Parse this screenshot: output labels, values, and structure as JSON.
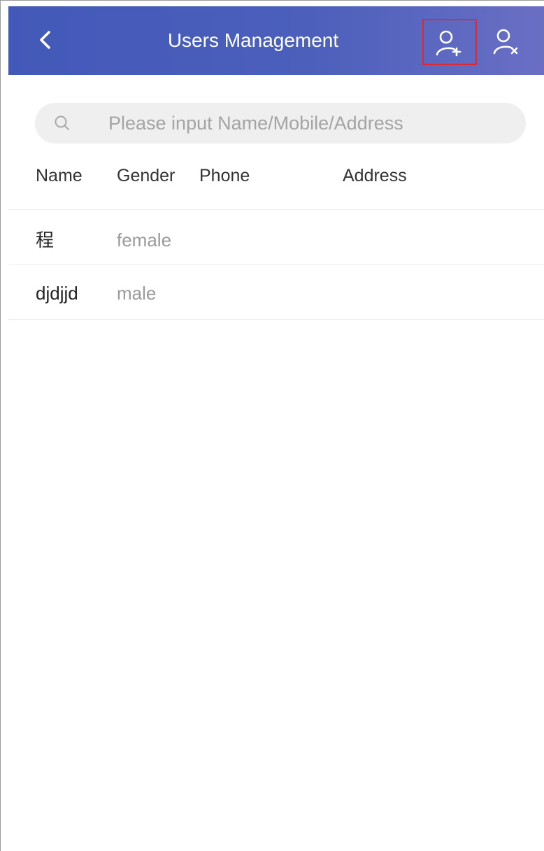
{
  "header": {
    "title": "Users Management",
    "back_icon": "chevron-left-icon",
    "add_user_icon": "user-add-icon",
    "remove_user_icon": "user-remove-icon",
    "background_colors": [
      "#4359b9",
      "#6a6fc4"
    ],
    "highlight_color": "#e0282f"
  },
  "search": {
    "placeholder": "Please input Name/Mobile/Address",
    "value": "",
    "icon": "search-icon"
  },
  "table": {
    "columns": [
      "Name",
      "Gender",
      "Phone",
      "Address"
    ],
    "rows": [
      {
        "name": "程",
        "gender": "female",
        "phone": "",
        "address": ""
      },
      {
        "name": "djdjjd",
        "gender": "male",
        "phone": "",
        "address": ""
      }
    ]
  }
}
